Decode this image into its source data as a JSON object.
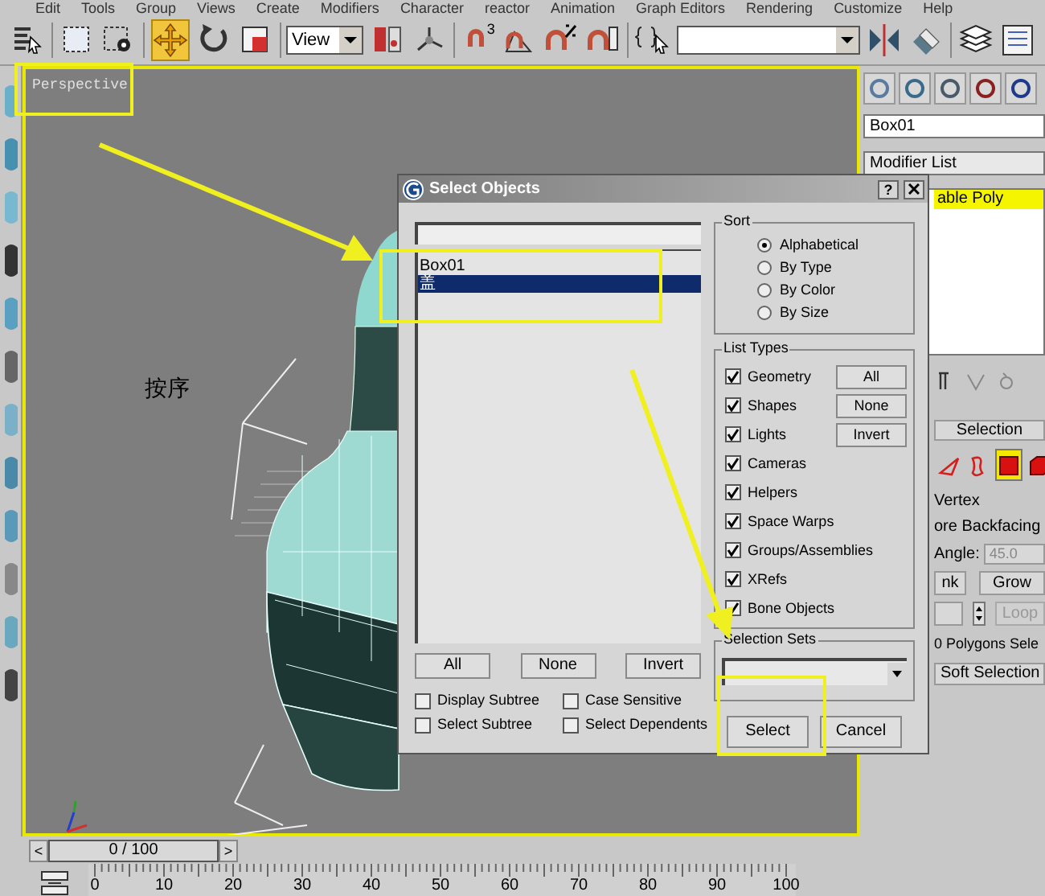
{
  "menu_bar": [
    "Edit",
    "Tools",
    "Group",
    "Views",
    "Create",
    "Modifiers",
    "Character",
    "reactor",
    "Animation",
    "Graph Editors",
    "Rendering",
    "Customize",
    "Help"
  ],
  "toolbar": [
    {
      "kind": "select_list",
      "selected": false
    },
    {
      "kind": "rect_region",
      "selected": false
    },
    {
      "kind": "select_object",
      "selected": false
    },
    {
      "kind": "move",
      "selected": true
    },
    {
      "kind": "rotate",
      "selected": false
    },
    {
      "kind": "scale",
      "selected": false
    },
    {
      "kind": "dropdown",
      "value": "View",
      "selected": false
    },
    {
      "kind": "pivot",
      "selected": false
    },
    {
      "kind": "axis",
      "selected": false
    },
    {
      "kind": "snap",
      "label": "3",
      "selected": false
    },
    {
      "kind": "angle_snap",
      "selected": false
    },
    {
      "kind": "percent_snap",
      "selected": false
    },
    {
      "kind": "spinner_snap",
      "selected": false
    },
    {
      "kind": "edit_sets",
      "selected": false
    },
    {
      "kind": "named_sets",
      "selected": false
    },
    {
      "kind": "mirror",
      "selected": false
    },
    {
      "kind": "align",
      "selected": false
    },
    {
      "kind": "layers",
      "selected": false
    },
    {
      "kind": "schematic",
      "selected": false
    }
  ],
  "viewport": {
    "label": "Perspective",
    "caption": "按序"
  },
  "command_panel": {
    "object_name": "Box01",
    "modifier_list": "Modifier List",
    "stack": [
      {
        "label": "able Poly",
        "selected": true
      }
    ],
    "selection_rollout": {
      "title": "Selection",
      "subobjects": [
        {
          "kind": "border",
          "selected": false
        },
        {
          "kind": "loop",
          "selected": false
        },
        {
          "kind": "polygon",
          "selected": true
        },
        {
          "kind": "element",
          "selected": false
        }
      ],
      "by_vertex": "Vertex",
      "ignore_backfacing": "ore Backfacing",
      "angle_label": "Angle:",
      "angle_value": "45.0",
      "buttons": [
        "nk",
        "Grow"
      ],
      "loop_button": "Loop",
      "status": "0 Polygons Sele"
    },
    "soft_selection": "Soft Selection"
  },
  "dialog": {
    "title": "Select Objects",
    "help": "?",
    "objects": [
      {
        "name": "Box01",
        "selected": false
      },
      {
        "name": "盖",
        "selected": true
      }
    ],
    "list_buttons": [
      "All",
      "None",
      "Invert"
    ],
    "options": [
      {
        "label": "Display Subtree",
        "checked": false
      },
      {
        "label": "Case Sensitive",
        "checked": false
      },
      {
        "label": "Select Subtree",
        "checked": false
      },
      {
        "label": "Select Dependents",
        "checked": false
      }
    ],
    "sort": {
      "title": "Sort",
      "options": [
        {
          "label": "Alphabetical",
          "selected": true
        },
        {
          "label": "By Type",
          "selected": false
        },
        {
          "label": "By Color",
          "selected": false
        },
        {
          "label": "By Size",
          "selected": false
        }
      ]
    },
    "list_types": {
      "title": "List Types",
      "types": [
        {
          "label": "Geometry",
          "checked": true
        },
        {
          "label": "Shapes",
          "checked": true
        },
        {
          "label": "Lights",
          "checked": true
        },
        {
          "label": "Cameras",
          "checked": true
        },
        {
          "label": "Helpers",
          "checked": true
        },
        {
          "label": "Space Warps",
          "checked": true
        },
        {
          "label": "Groups/Assemblies",
          "checked": true
        },
        {
          "label": "XRefs",
          "checked": true
        },
        {
          "label": "Bone Objects",
          "checked": true
        }
      ],
      "buttons": [
        "All",
        "None",
        "Invert"
      ]
    },
    "selection_sets": {
      "title": "Selection Sets"
    },
    "buttons": [
      "Select",
      "Cancel"
    ]
  },
  "timeline": {
    "slider": {
      "previous": "<",
      "label": "0 / 100",
      "next": ">"
    },
    "ticks": [
      "0",
      "10",
      "20",
      "30",
      "40",
      "50",
      "60",
      "70",
      "80",
      "90",
      "100"
    ]
  }
}
